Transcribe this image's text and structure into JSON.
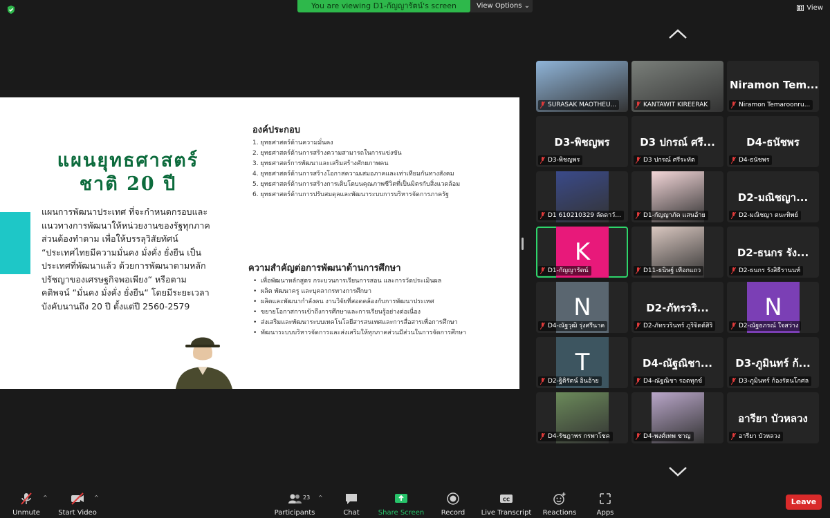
{
  "topbar": {
    "viewing": "You are viewing D1-กัญญารัตน์'s screen",
    "view_options": "View Options",
    "view": "View"
  },
  "slide": {
    "title_line1": "แผนยุทธศาสตร์",
    "title_line2": "ชาติ 20 ปี",
    "description": "แผนการพัฒนาประเทศ ที่จะกำหนดกรอบและแนวทางการพัฒนาให้หน่วยงานของรัฐทุกภาคส่วนต้องทำตาม เพื่อให้บรรลุวิสัยทัศน์ “ประเทศไทยมีความมั่นคง มั่งคั่ง ยั่งยืน เป็นประเทศที่พัฒนาแล้ว ด้วยการพัฒนาตามหลักปรัชญาของเศรษฐกิจพอเพียง“ หรือตามคติพจน์ “มั่นคง มั่งคั่ง ยั่งยืน“ โดยมีระยะเวลาบังคับนานถึง 20 ปี ตั้งแต่ปี 2560-2579",
    "components_title": "องค์ประกอบ",
    "components": [
      "1. ยุทธศาสตร์ด้านความมั่นคง",
      "2. ยุทธศาสตร์ด้านการสร้างความสามารถในการแข่งขัน",
      "3. ยุทธศาสตร์การพัฒนาและเสริมสร้างศักยภาพคน",
      "4. ยุทธศาสตร์ด้านการสร้างโอกาสความเสมอภาคและเท่าเทียมกันทางสังคม",
      "5. ยุทธศาสตร์ด้านการสร้างการเติบโตบนคุณภาพชีวิตที่เป็นมิตรกับสิ่งแวดล้อม",
      "6. ยุทธศาสตร์ด้านการปรับสมดุลและพัฒนาระบบการบริหารจัดการภาครัฐ"
    ],
    "importance_title": "ความสำคัญต่อการพัฒนาด้านการศึกษา",
    "importance": [
      "เพื่อพัฒนาหลักสูตร กระบวนการเรียนการสอน และการวัดประเมินผล",
      "ผลิต พัฒนาครู และบุคลากรทางการศึกษา",
      "ผลิตและพัฒนากำลังคน งานวิจัยที่สอดคล้องกับการพัฒนาประเทศ",
      "ขยายโอกาสการเข้าถึงการศึกษาและการเรียนรู้อย่างต่อเนื่อง",
      "ส่งเสริมและพัฒนาระบบเทคโนโลยีสารสนเทศและการสื่อสารเพื่อการศึกษา",
      "พัฒนาระบบบริหารจัดการและส่งเสริมให้ทุกภาคส่วนมีส่วนในการจัดการศึกษา"
    ]
  },
  "participants": [
    {
      "label": "SURASAK MAOTHEU...",
      "type": "photo",
      "color": "#8fb4d8"
    },
    {
      "label": "KANTAWIT KIREERAK",
      "type": "photo",
      "color": "#7a7f7a"
    },
    {
      "label": "Niramon Temaroonru...",
      "big": "Niramon Tem...",
      "type": "name"
    },
    {
      "label": "D3-พิชญพร",
      "big": "D3-พิชญพร",
      "type": "name"
    },
    {
      "label": "D3 ปกรณ์ ศรีระทัต",
      "big": "D3 ปกรณ์ ศรี...",
      "type": "name"
    },
    {
      "label": "D4-ธนัชพร",
      "big": "D4-ธนัชพร",
      "type": "name"
    },
    {
      "label": "D1 610210329 ลัดดาวั...",
      "type": "photo",
      "color": "#3a4a8a"
    },
    {
      "label": "D1-กัญญาภัค แสนอ้าย",
      "type": "photo",
      "color": "#f3d6d8"
    },
    {
      "label": "D2-มณิชญา ตนะทิพย์",
      "big": "D2-มณิชญา...",
      "type": "name"
    },
    {
      "label": "D1-กัญญารัตน์",
      "letter": "K",
      "type": "letter",
      "color": "#e8197a"
    },
    {
      "label": "D11-ธนิษฐ์ เทือกแถว",
      "type": "photo",
      "color": "#d9c7c0"
    },
    {
      "label": "D2-ธนกร รังสิธีรานนท์",
      "big": "D2-ธนกร รัง...",
      "type": "name"
    },
    {
      "label": "D4-ณัฐวุฒิ รุ่งศรีนาค",
      "letter": "N",
      "type": "letter",
      "color": "#5a6670"
    },
    {
      "label": "D2-ภัทรวรินทร์ ภูริจิตต์สิริ",
      "big": "D2-ภัทรวริ...",
      "type": "name"
    },
    {
      "label": "D2-ณัฐธภรณ์ ใจสว่าง",
      "letter": "N",
      "type": "letter",
      "color": "#7b3fb5"
    },
    {
      "label": "D2-ฐิติรัตน์ อินอ้าย",
      "letter": "T",
      "type": "letter",
      "color": "#3d5560"
    },
    {
      "label": "D4-ณัฐณิชา รอดทุกข์",
      "big": "D4-ณัฐณิชา...",
      "type": "name"
    },
    {
      "label": "D3-ภูมินทร์ ก้องรัตนโกศล",
      "big": "D3-ภูมินทร์ ก้...",
      "type": "name"
    },
    {
      "label": "D4-รัชฎาพร กรพาโชค",
      "type": "photo",
      "color": "#6b8a5a"
    },
    {
      "label": "D4-พงศ์เทพ ชาญ",
      "type": "photo",
      "color": "#b9a6c9"
    },
    {
      "label": "อารียา บัวหลวง",
      "big": "อารียา บัวหลวง",
      "type": "name"
    }
  ],
  "toolbar": {
    "unmute": "Unmute",
    "start_video": "Start Video",
    "participants": "Participants",
    "participant_count": "23",
    "chat": "Chat",
    "share_screen": "Share Screen",
    "record": "Record",
    "live_transcript": "Live Transcript",
    "reactions": "Reactions",
    "apps": "Apps",
    "leave": "Leave"
  },
  "colors": {
    "accent_green": "#2eb84b",
    "leave_red": "#d92a2a",
    "slide_title_green": "#0c6b3c",
    "teal": "#1ec7c7"
  }
}
